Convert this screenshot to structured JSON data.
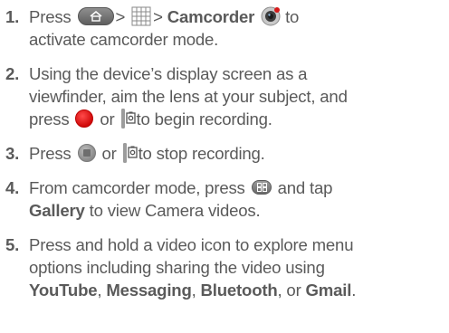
{
  "steps": [
    {
      "num": "1.",
      "t1": "Press",
      "t2": ">",
      "t3": ">",
      "b1": "Camcorder",
      "t4": "to",
      "t5": "activate camcorder mode."
    },
    {
      "num": "2.",
      "t1": "Using the device’s display screen as a",
      "t2": "viewfinder, aim the lens at your subject, and",
      "t3": "press",
      "t4": "or",
      "t5": "to begin recording."
    },
    {
      "num": "3.",
      "t1": "Press",
      "t2": "or",
      "t3": "to stop recording."
    },
    {
      "num": "4.",
      "t1": "From camcorder mode, press",
      "t2": "and tap",
      "b1": "Gallery",
      "t3": "to view Camera videos."
    },
    {
      "num": "5.",
      "t1": "Press and hold a video icon to explore menu",
      "t2": "options including sharing the video using",
      "b1": "YouTube",
      "c1": ",",
      "b2": "Messaging",
      "c2": ",",
      "b3": "Bluetooth",
      "c3": ", or",
      "b4": "Gmail",
      "c4": "."
    }
  ],
  "icons": {
    "home": "home-key-icon",
    "apps": "apps-grid-icon",
    "camcorder": "camcorder-app-icon",
    "record": "record-button-icon",
    "side_key": "side-camera-key-icon",
    "stop": "stop-button-icon",
    "menu": "menu-key-icon"
  },
  "colors": {
    "text": "#5a5a5a",
    "record_red": "#d10a0a"
  }
}
